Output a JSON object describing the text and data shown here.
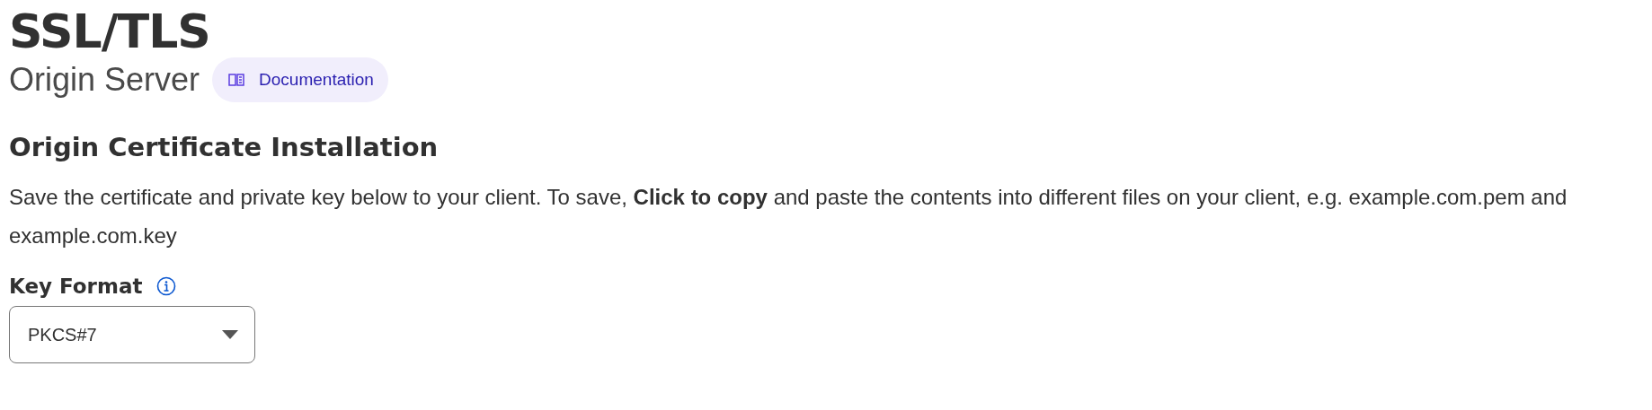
{
  "page": {
    "title": "SSL/TLS",
    "subtitle": "Origin Server",
    "doc_link": "Documentation"
  },
  "section": {
    "heading": "Origin Certificate Installation",
    "description": "Save the certificate and private key below to your client. To save, **Click to copy** and paste the contents into different files on your client, e.g. example.com.pem and example.com.key"
  },
  "key_format": {
    "label": "Key Format",
    "value": "PKCS#7"
  }
}
